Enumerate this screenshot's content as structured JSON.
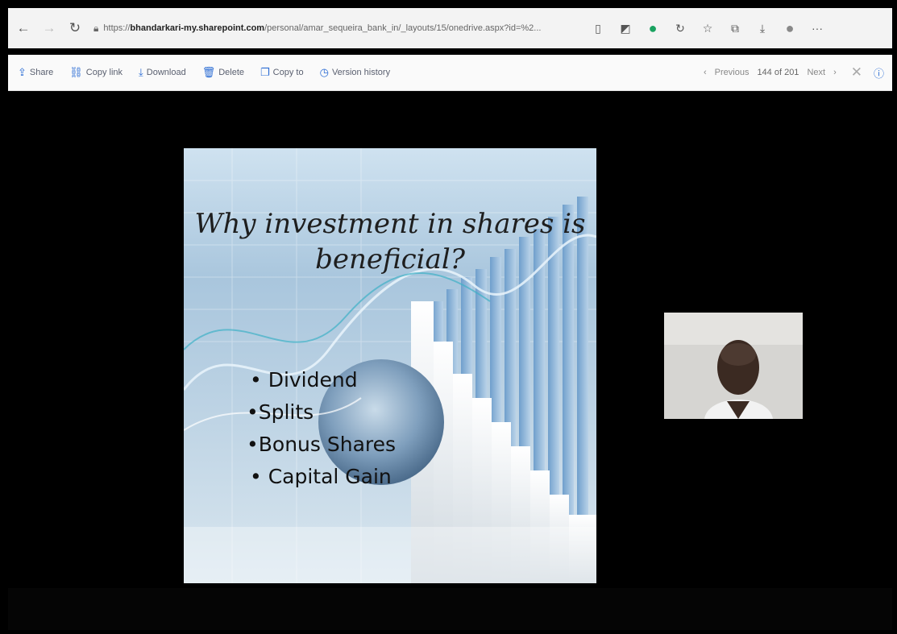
{
  "browser": {
    "url_prefix": "https://",
    "url_host": "bhandarkari-my.sharepoint.com",
    "url_path": "/personal/amar_sequeira_bank_in/_layouts/15/onedrive.aspx?id=%2..."
  },
  "toolbar": {
    "share_label": "Share",
    "copy_link_label": "Copy link",
    "download_label": "Download",
    "delete_label": "Delete",
    "copy_to_label": "Copy to",
    "version_history_label": "Version history",
    "previous_label": "Previous",
    "page_count": "144 of 201",
    "next_label": "Next"
  },
  "slide": {
    "title_line1": "Why investment in shares is",
    "title_line2": "beneficial?",
    "bullets": [
      "• Dividend",
      "•Splits",
      "•Bonus Shares",
      "• Capital Gain"
    ]
  },
  "colors": {
    "accent": "#2b6cd4",
    "background": "#000000",
    "browser_bar": "#f3f3f3"
  },
  "icons": [
    "back-icon",
    "forward-icon",
    "refresh-icon",
    "lock-icon",
    "reader-icon",
    "extension-icon",
    "green-extension-icon",
    "sync-icon",
    "favorite-icon",
    "collections-icon",
    "download-icon",
    "profile-icon",
    "more-icon",
    "share-icon",
    "link-icon",
    "download-icon",
    "delete-icon",
    "copy-icon",
    "history-icon",
    "chevron-left-icon",
    "chevron-right-icon",
    "close-icon",
    "info-icon"
  ]
}
